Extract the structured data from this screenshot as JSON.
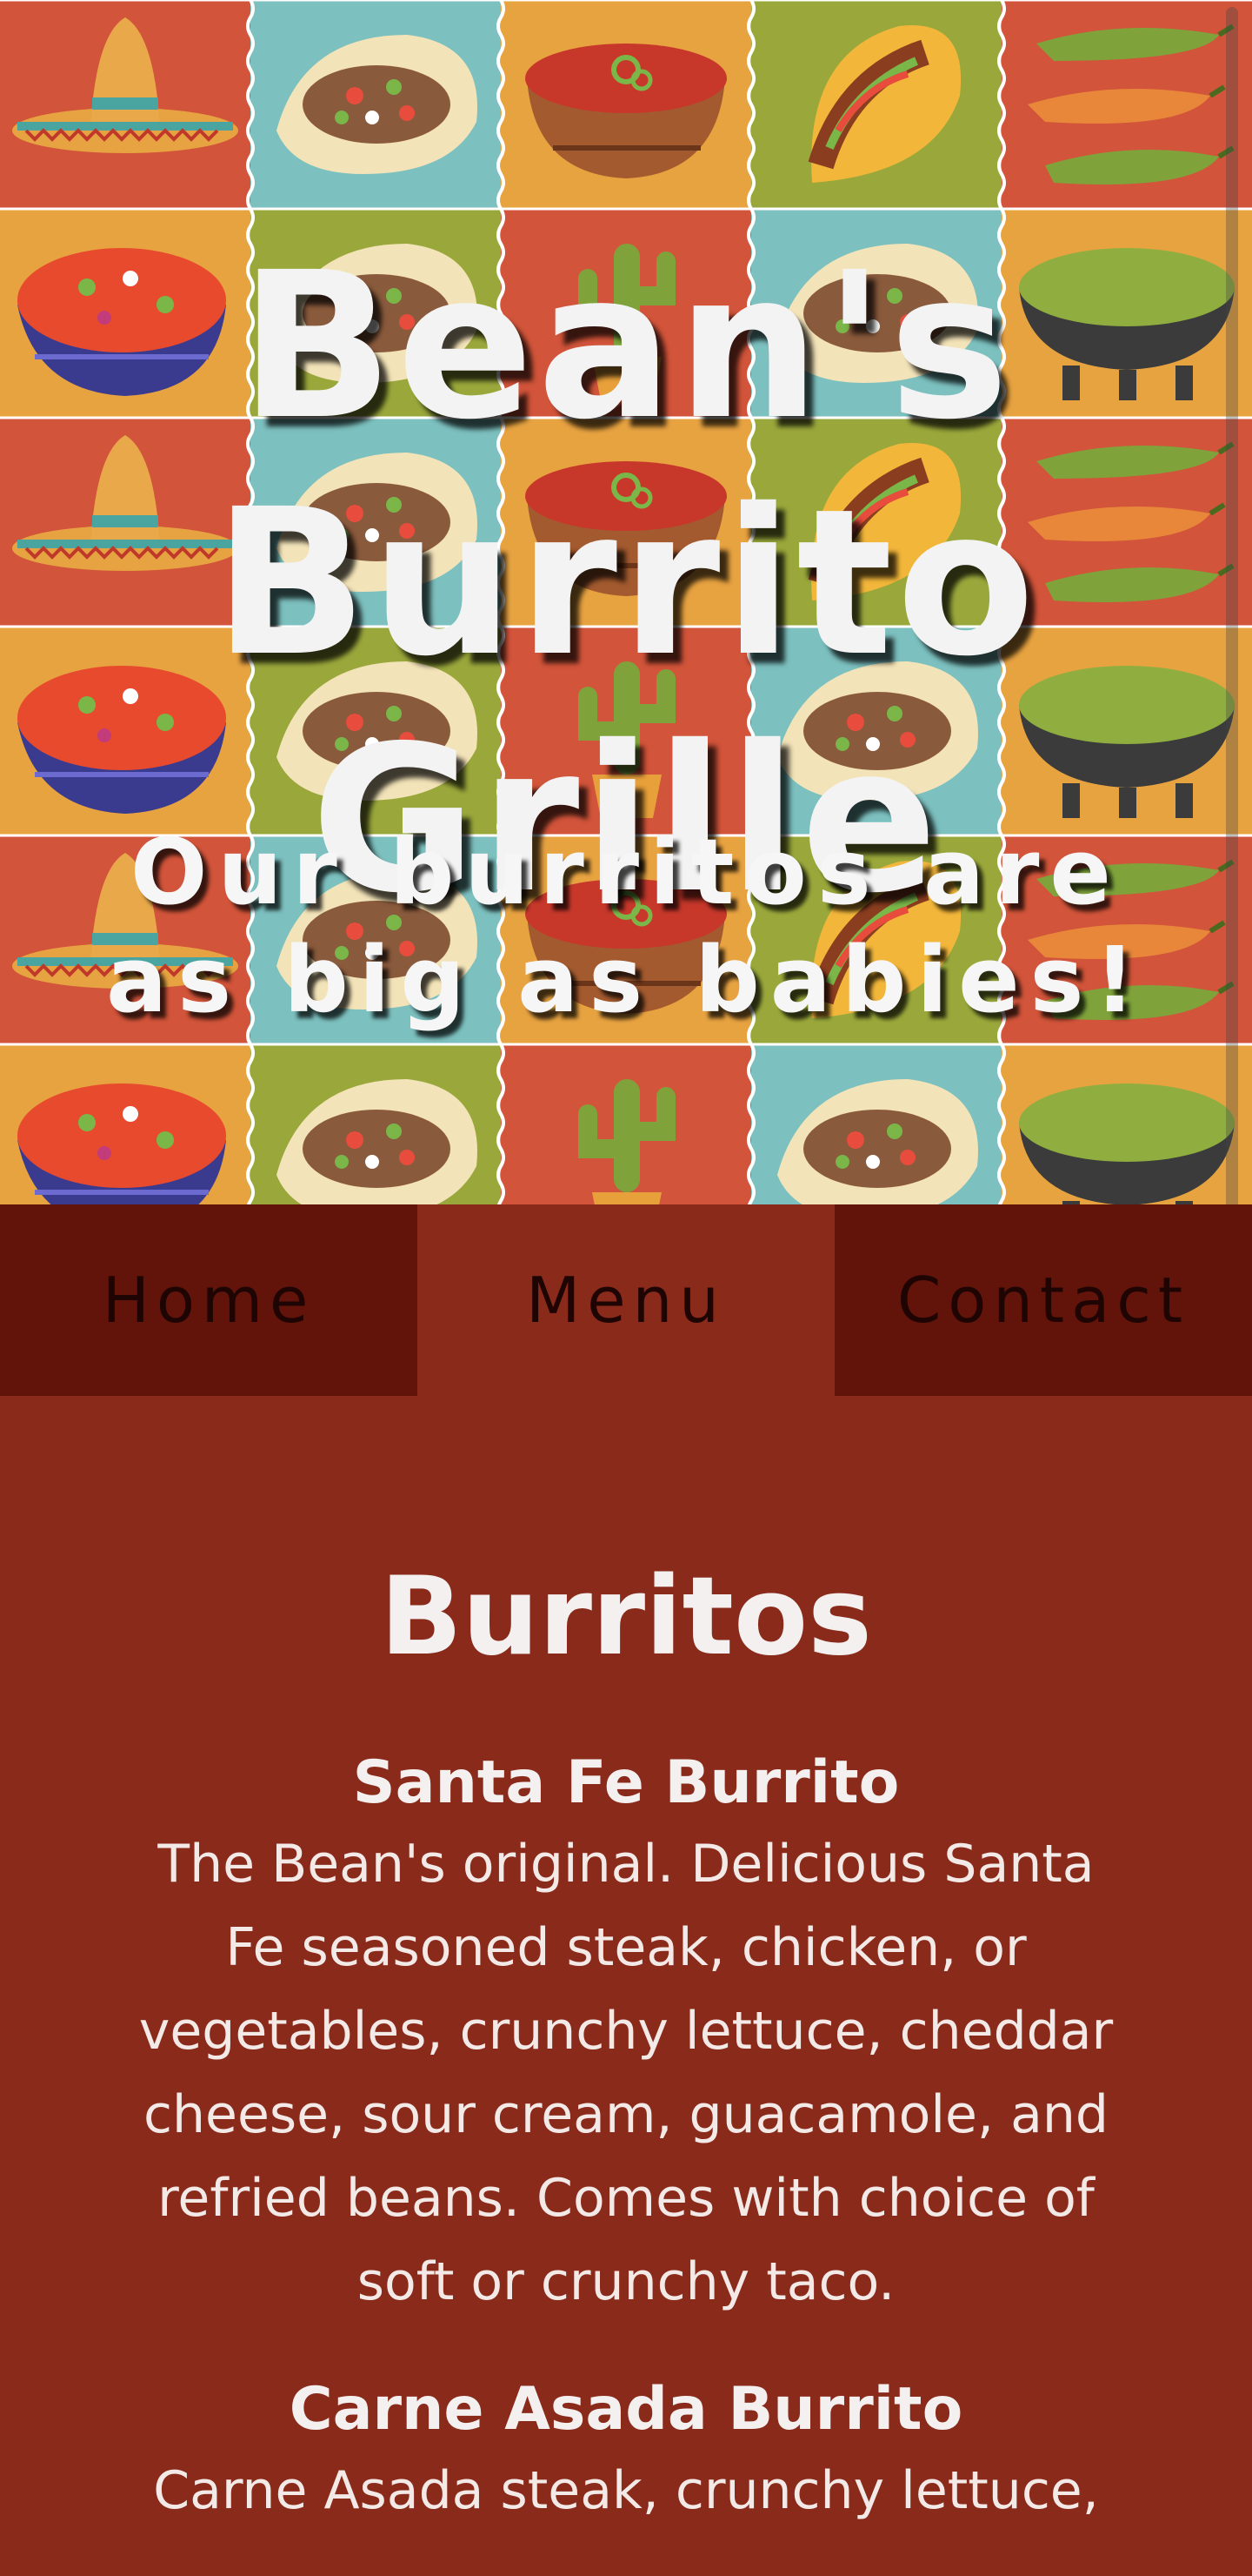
{
  "header": {
    "title": "Bean's Burrito Grille",
    "tagline": "Our burritos are as big as babies!"
  },
  "nav": {
    "items": [
      {
        "label": "Home"
      },
      {
        "label": "Menu",
        "active": true
      },
      {
        "label": "Contact"
      }
    ]
  },
  "menu": {
    "section_title": "Burritos",
    "items": [
      {
        "name": "Santa Fe Burrito",
        "description": "The Bean's original. Delicious Santa Fe seasoned steak, chicken, or vegetables, crunchy lettuce, cheddar cheese, sour cream, guacamole, and refried beans. Comes with choice of soft or crunchy taco."
      },
      {
        "name": "Carne Asada Burrito",
        "description": "Carne Asada steak, crunchy lettuce,"
      }
    ]
  },
  "colors": {
    "page_background": "#8a2a1b",
    "nav_background": "#62140b",
    "nav_active": "#8a2a1b",
    "text_light": "#f3f0ef"
  },
  "hero_tiles": [
    "sombrero-icon",
    "taco-icon",
    "salsa-bowl-icon",
    "hard-taco-icon",
    "chili-peppers-icon",
    "pico-bowl-icon",
    "taco-icon",
    "cactus-icon",
    "taco-icon",
    "guacamole-bowl-icon"
  ]
}
